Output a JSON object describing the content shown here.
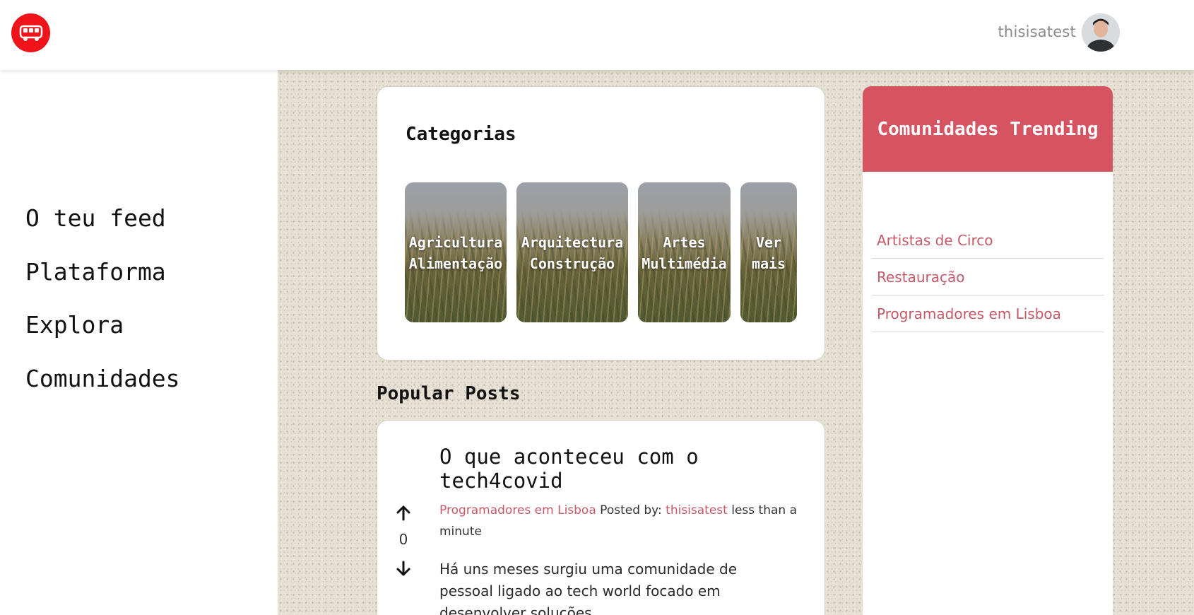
{
  "header": {
    "logo_icon": "bus-icon",
    "username": "thisisatest",
    "avatar_icon": "user-avatar"
  },
  "sidebar": {
    "items": [
      {
        "label": "O teu feed"
      },
      {
        "label": "Plataforma"
      },
      {
        "label": "Explora"
      },
      {
        "label": "Comunidades"
      }
    ]
  },
  "categories": {
    "title": "Categorias",
    "tiles": [
      {
        "label": "Agricultura\nAlimentação"
      },
      {
        "label": "Arquitectura\nConstrução"
      },
      {
        "label": "Artes\nMultimédia"
      },
      {
        "label": "Ver\nmais"
      }
    ]
  },
  "popular": {
    "title": "Popular Posts",
    "post": {
      "title": "O que aconteceu com o tech4covid",
      "votes": "0",
      "community": "Programadores em Lisboa",
      "posted_by_label": "Posted by:",
      "author": "thisisatest",
      "time": "less than a minute",
      "body": "Há uns meses surgiu uma comunidade de pessoal ligado ao tech world focado em desenvolver soluções"
    }
  },
  "trending": {
    "title": "Comunidades Trending",
    "items": [
      {
        "label": "Artistas de Circo"
      },
      {
        "label": "Restauração"
      },
      {
        "label": "Programadores em Lisboa"
      }
    ]
  },
  "colors": {
    "brand_red": "#f0131a",
    "accent_pink": "#d65462",
    "link": "#c45a68"
  }
}
